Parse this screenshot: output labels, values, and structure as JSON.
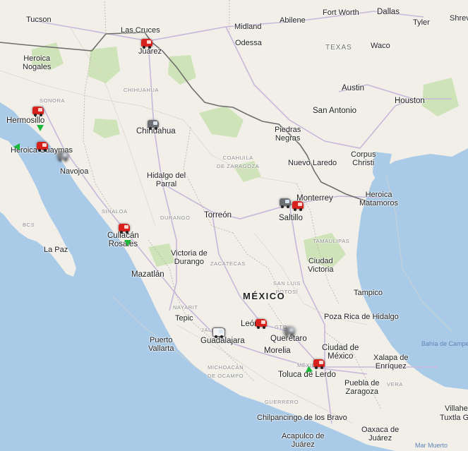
{
  "colors": {
    "water": "#a9cbe8",
    "land": "#f1efe8",
    "park": "#cfe3b8",
    "highway": "#c8b7dc",
    "border": "#6e6e6e",
    "marker_red": "#d8201c",
    "arrow_green": "#1bb83a"
  },
  "labels": {
    "tucson": "Tucson",
    "las_cruces": "Las Cruces",
    "juarez": "Juárez",
    "midland": "Midland",
    "abilene": "Abilene",
    "fort_worth": "Fort Worth",
    "dallas": "Dallas",
    "tyler": "Tyler",
    "shreveport": "Shrev",
    "odessa": "Odessa",
    "waco": "Waco",
    "texas": "TEXAS",
    "heroica_nogales": "Heroica\nNogales",
    "sonora": "SONORA",
    "chihuahua_state": "CHIHUAHUA",
    "austin": "Austin",
    "houston": "Houston",
    "san_antonio": "San Antonio",
    "hermosillo": "Hermosillo",
    "chihuahua_city": "Chihuahua",
    "piedras_negras": "Piedras\nNegras",
    "heroica_guaymas": "Heroica Guaymas",
    "coahuila": "COAHUILA\nDE ZARAGOZA",
    "nuevo_laredo": "Nuevo Laredo",
    "corpus_christi": "Corpus\nChristi",
    "navojoa": "Navojoa",
    "hidalgo_parral": "Hidalgo del\nParral",
    "heroica_matamoros": "Heroica\nMatamoros",
    "monterrey": "Monterrey",
    "bcs": "BCS",
    "sinaloa": "SINALOA",
    "durango_state": "DURANGO",
    "torreon": "Torreón",
    "saltillo": "Saltillo",
    "culiacan": "Culiacán\nRosales",
    "tamaulipas": "TAMAULIPAS",
    "la_paz": "La Paz",
    "victoria_durango": "Victoria de\nDurango",
    "zacatecas": "ZACATECAS",
    "ciudad_victoria": "Ciudad\nVictoria",
    "mazatlan": "Mazatlán",
    "slp": "SAN LUIS\nPOTOSÍ",
    "tampico": "Tampico",
    "mexico": "MÉXICO",
    "nayarit": "NAYARIT",
    "poza_rica": "Poza Rica de Hidalgo",
    "tepic": "Tepic",
    "leon": "León",
    "gto": "GTO",
    "jalisco": "JALISCO",
    "bahia_campeche": "Bahía de Campe",
    "puerto_vallarta": "Puerto\nVallarta",
    "guadalajara": "Guadalajara",
    "queretaro": "Querétaro",
    "morelia": "Morelia",
    "ciudad_mexico": "Ciudad de\nMéxico",
    "xalapa": "Xalapa de\nEnríquez",
    "michoacan": "MICHOACÁN\nDE OCAMPO",
    "mexico_state": "MÉXICO",
    "toluca": "Toluca de Lerdo",
    "puebla": "Puebla de\nZaragoza",
    "veracruz": "VERA",
    "guerrero": "GUERRERO",
    "villahermosa": "Villahe",
    "chilpancingo": "Chilpancingo de los Bravo",
    "tuxtla": "Tuxtla Gu",
    "oaxaca": "Oaxaca de\nJuárez",
    "acapulco": "Acapulco de\nJuárez",
    "mar_muerto": "Mar Muerto"
  }
}
